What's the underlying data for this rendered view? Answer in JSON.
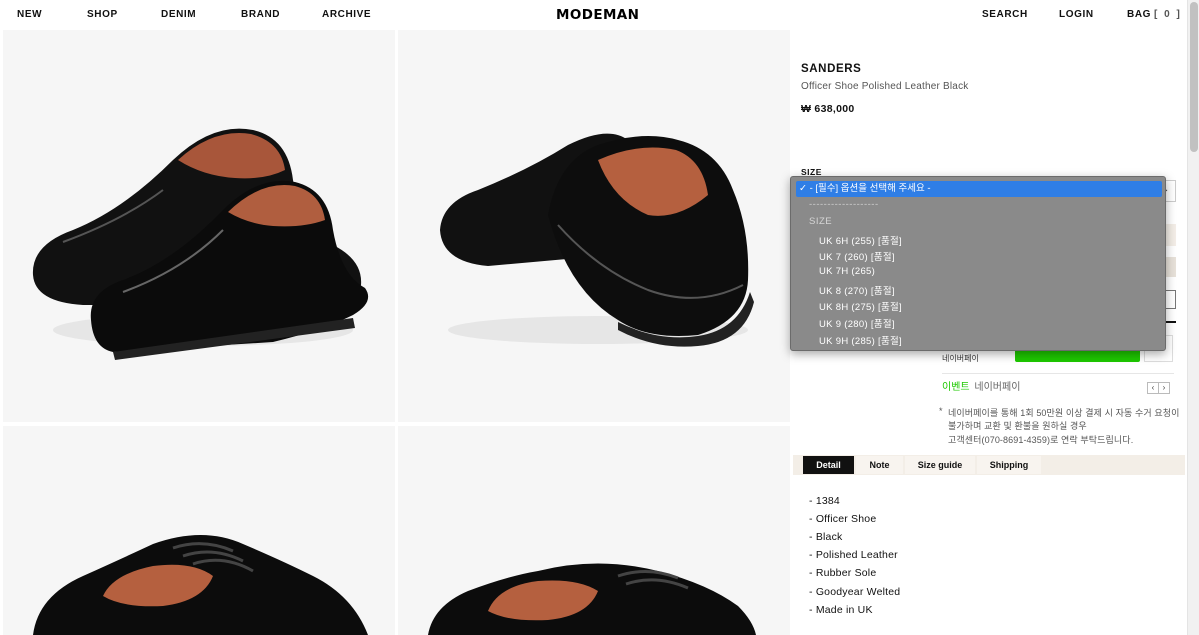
{
  "nav": {
    "left": [
      "NEW",
      "SHOP",
      "DENIM",
      "BRAND",
      "ARCHIVE"
    ],
    "logo": "MODEMAN",
    "search": "SEARCH",
    "login": "LOGIN",
    "bag": "BAG",
    "bag_count": "[ 0 ]"
  },
  "product": {
    "brand": "SANDERS",
    "name": "Officer Shoe Polished Leather Black",
    "price": "₩ 638,000",
    "size_label": "SIZE"
  },
  "size_dropdown": {
    "selected": "- [필수] 옵션을 선택해 주세요 -",
    "separator": "-------------------",
    "group_label": "SIZE",
    "options": [
      "UK 6H (255) [품절]",
      "UK 7 (260) [품절]",
      "UK 7H (265)",
      "UK 8 (270) [품절]",
      "UK 8H (275) [품절]",
      "UK 9 (280) [품절]",
      "UK 9H (285) [품절]"
    ]
  },
  "naverpay": {
    "label": "네이버페이",
    "event_label": "이벤트",
    "event_provider": "네이버페이",
    "notice": [
      "네이버페이를 통해 1회 50만원 이상 결제 시 자동 수거 요청이",
      "불가하며 교환 및 환불을 원하실 경우",
      "고객센터(070-8691-4359)로 연락 부탁드립니다."
    ],
    "notice_marker": "*"
  },
  "tabs": [
    "Detail",
    "Note",
    "Size guide",
    "Shipping"
  ],
  "detail_lines": [
    "- 1384",
    "- Officer Shoe",
    "- Black",
    "- Polished Leather",
    "- Rubber Sole",
    "- Goodyear Welted",
    "- Made in UK"
  ],
  "colors": {
    "accent_select": "#2f7ee6",
    "naverpay_green": "#1ec800",
    "tab_active": "#111111"
  }
}
